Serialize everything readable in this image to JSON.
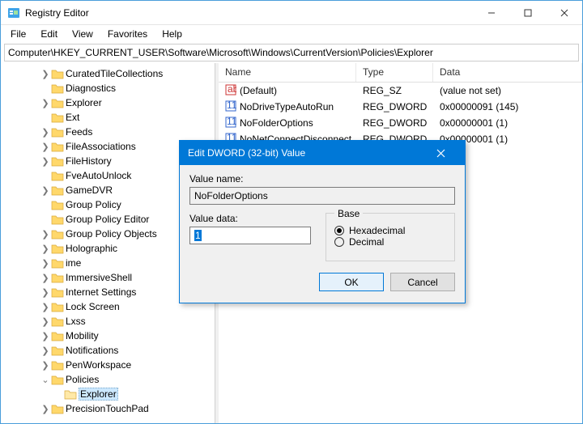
{
  "title": "Registry Editor",
  "menu": [
    "File",
    "Edit",
    "View",
    "Favorites",
    "Help"
  ],
  "address": "Computer\\HKEY_CURRENT_USER\\Software\\Microsoft\\Windows\\CurrentVersion\\Policies\\Explorer",
  "tree": [
    {
      "indent": 3,
      "twist": ">",
      "label": "CuratedTileCollections"
    },
    {
      "indent": 3,
      "twist": "",
      "label": "Diagnostics"
    },
    {
      "indent": 3,
      "twist": ">",
      "label": "Explorer"
    },
    {
      "indent": 3,
      "twist": "",
      "label": "Ext"
    },
    {
      "indent": 3,
      "twist": ">",
      "label": "Feeds"
    },
    {
      "indent": 3,
      "twist": ">",
      "label": "FileAssociations"
    },
    {
      "indent": 3,
      "twist": ">",
      "label": "FileHistory"
    },
    {
      "indent": 3,
      "twist": "",
      "label": "FveAutoUnlock"
    },
    {
      "indent": 3,
      "twist": ">",
      "label": "GameDVR"
    },
    {
      "indent": 3,
      "twist": "",
      "label": "Group Policy"
    },
    {
      "indent": 3,
      "twist": "",
      "label": "Group Policy Editor"
    },
    {
      "indent": 3,
      "twist": ">",
      "label": "Group Policy Objects"
    },
    {
      "indent": 3,
      "twist": ">",
      "label": "Holographic"
    },
    {
      "indent": 3,
      "twist": ">",
      "label": "ime"
    },
    {
      "indent": 3,
      "twist": ">",
      "label": "ImmersiveShell"
    },
    {
      "indent": 3,
      "twist": ">",
      "label": "Internet Settings"
    },
    {
      "indent": 3,
      "twist": ">",
      "label": "Lock Screen"
    },
    {
      "indent": 3,
      "twist": ">",
      "label": "Lxss"
    },
    {
      "indent": 3,
      "twist": ">",
      "label": "Mobility"
    },
    {
      "indent": 3,
      "twist": ">",
      "label": "Notifications"
    },
    {
      "indent": 3,
      "twist": ">",
      "label": "PenWorkspace"
    },
    {
      "indent": 3,
      "twist": "v",
      "label": "Policies"
    },
    {
      "indent": 4,
      "twist": "",
      "label": "Explorer",
      "selected": true
    },
    {
      "indent": 3,
      "twist": ">",
      "label": "PrecisionTouchPad"
    }
  ],
  "columns": {
    "name": "Name",
    "type": "Type",
    "data": "Data"
  },
  "rows": [
    {
      "icon": "sz",
      "name": "(Default)",
      "type": "REG_SZ",
      "data": "(value not set)"
    },
    {
      "icon": "dw",
      "name": "NoDriveTypeAutoRun",
      "type": "REG_DWORD",
      "data": "0x00000091 (145)"
    },
    {
      "icon": "dw",
      "name": "NoFolderOptions",
      "type": "REG_DWORD",
      "data": "0x00000001 (1)"
    },
    {
      "icon": "dw",
      "name": "NoNetConnectDisconnect",
      "type": "REG_DWORD",
      "data": "0x00000001 (1)"
    }
  ],
  "dialog": {
    "title": "Edit DWORD (32-bit) Value",
    "value_name_label": "Value name:",
    "value_name": "NoFolderOptions",
    "value_data_label": "Value data:",
    "value_data": "1",
    "base_label": "Base",
    "hex_label": "Hexadecimal",
    "dec_label": "Decimal",
    "ok": "OK",
    "cancel": "Cancel"
  }
}
